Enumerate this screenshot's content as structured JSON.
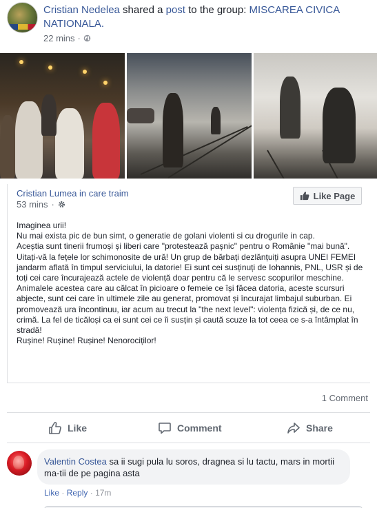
{
  "post": {
    "author": "Cristian Nedelea",
    "shared_text": " shared a ",
    "post_link": "post",
    "to_group_text": " to the group: ",
    "group": "MISCAREA CIVICA NATIONALA.",
    "time": "22 mins",
    "privacy_icon": "globe-icon"
  },
  "shared_post": {
    "author": "Cristian Lumea in care traim",
    "time": "53 mins",
    "privacy_icon": "gear-icon",
    "like_page_label": "Like Page",
    "paragraphs": [
      "Imaginea urii!",
      "Nu mai exista pic de bun simt, o generatie de golani violenti si cu drogurile in cap.",
      "Aceștia sunt tinerii frumoși și liberi care \"protestează pașnic\" pentru o Românie \"mai bună\". Uitați-vă la fețele lor schimonosite de ură! Un grup de bărbați dezlănțuiți asupra UNEI FEMEI jandarm aflată în timpul serviciului, la datorie! Ei sunt cei susținuți de Iohannis, PNL, USR și de toți cei care încurajează actele de violență doar pentru că le servesc scopurilor meschine.",
      "Animalele acestea care au călcat în picioare o femeie ce își făcea datoria, aceste scursuri abjecte, sunt cei care în ultimele zile au generat, promovat și încurajat limbajul suburban. Ei promovează ura încontinuu, iar acum au trecut la \"the next level\": violența fizică și, de ce nu, crimă. La fel de ticăloși ca ei sunt cei ce îi susțin și caută scuze la tot ceea ce s-a întâmplat în stradă!",
      "Rușine! Rușine! Rușine! Nenorociților!"
    ]
  },
  "engagement": {
    "comment_count": "1 Comment"
  },
  "actions": {
    "like": "Like",
    "comment": "Comment",
    "share": "Share"
  },
  "comment": {
    "author": "Valentin Costea",
    "text": "sa ii sugi pula lu soros, dragnea si lu tactu, mars in mortii ma-tii de pe pagina asta",
    "like": "Like",
    "separator": "·",
    "reply": "Reply",
    "time": "17m"
  },
  "colors": {
    "link": "#385898",
    "meta": "#616770",
    "action": "#606770",
    "bubble": "#f2f3f5"
  }
}
